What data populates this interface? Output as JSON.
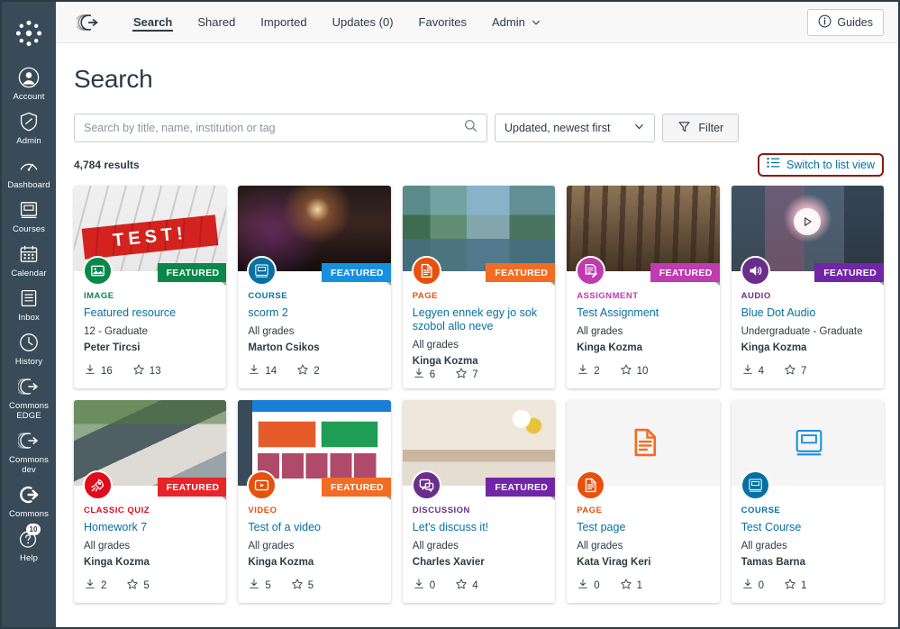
{
  "sidebar": {
    "logo_icon": "canvas-logo-icon",
    "items": [
      {
        "label": "Account",
        "icon": "user-avatar-icon"
      },
      {
        "label": "Admin",
        "icon": "shield-icon"
      },
      {
        "label": "Dashboard",
        "icon": "speedometer-icon"
      },
      {
        "label": "Courses",
        "icon": "book-icon"
      },
      {
        "label": "Calendar",
        "icon": "calendar-icon"
      },
      {
        "label": "Inbox",
        "icon": "envelope-icon"
      },
      {
        "label": "History",
        "icon": "clock-icon"
      },
      {
        "label": "Commons EDGE",
        "icon": "commons-arrow-icon"
      },
      {
        "label": "Commons dev",
        "icon": "commons-arrow-icon"
      },
      {
        "label": "Commons",
        "icon": "commons-arrow-bold-icon"
      },
      {
        "label": "Help",
        "icon": "question-circle-icon",
        "badge": "10"
      }
    ]
  },
  "topbar": {
    "brand_icon": "commons-logo-icon",
    "nav": [
      {
        "label": "Search",
        "active": true
      },
      {
        "label": "Shared",
        "active": false
      },
      {
        "label": "Imported",
        "active": false
      },
      {
        "label": "Updates (0)",
        "active": false
      },
      {
        "label": "Favorites",
        "active": false
      },
      {
        "label": "Admin",
        "active": false,
        "dropdown": true
      }
    ],
    "guides_label": "Guides",
    "guides_icon": "info-circle-icon"
  },
  "page": {
    "title": "Search",
    "results_count": "4,784 results"
  },
  "search": {
    "placeholder": "Search by title, name, institution or tag",
    "value": "",
    "icon": "search-icon"
  },
  "sort": {
    "selected": "Updated, newest first",
    "icon": "chevron-down-icon"
  },
  "filter": {
    "label": "Filter",
    "icon": "funnel-icon"
  },
  "switch_view": {
    "label": "Switch to list view",
    "icon": "list-view-icon",
    "highlight_color": "#8b1a10",
    "link_color": "#0770A3"
  },
  "cards": [
    {
      "type": "IMAGE",
      "type_color": "#0B874B",
      "icon": "image-icon",
      "title": "Featured resource",
      "grades": "12 - Graduate",
      "author": "Peter Tircsi",
      "downloads": "16",
      "stars": "13",
      "featured": true,
      "ribbon_label": "FEATURED",
      "ribbon_color": "#0B874B",
      "thumb": "thumb-keyboard",
      "thumb_text": "TEST!",
      "has_play": false
    },
    {
      "type": "COURSE",
      "type_color": "#0770A3",
      "icon": "book-icon",
      "title": "scorm 2",
      "grades": "All grades",
      "author": "Marton Csikos",
      "downloads": "14",
      "stars": "2",
      "featured": true,
      "ribbon_label": "FEATURED",
      "ribbon_color": "#1790DF",
      "thumb": "thumb-concert",
      "thumb_text": "",
      "has_play": false
    },
    {
      "type": "PAGE",
      "type_color": "#E8500C",
      "icon": "page-icon",
      "title": "Legyen ennek egy jo sok szobol allo neve",
      "grades": "All grades",
      "author": "Kinga Kozma",
      "downloads": "6",
      "stars": "7",
      "featured": true,
      "ribbon_label": "FEATURED",
      "ribbon_color": "#F26C24",
      "thumb": "thumb-river",
      "thumb_text": "",
      "has_play": false
    },
    {
      "type": "ASSIGNMENT",
      "type_color": "#BE3BB0",
      "icon": "assignment-icon",
      "title": "Test Assignment",
      "grades": "All grades",
      "author": "Kinga Kozma",
      "downloads": "2",
      "stars": "10",
      "featured": true,
      "ribbon_label": "FEATURED",
      "ribbon_color": "#BE3BB0",
      "thumb": "thumb-forest",
      "thumb_text": "",
      "has_play": false
    },
    {
      "type": "AUDIO",
      "type_color": "#6B2D8B",
      "icon": "audio-icon",
      "title": "Blue Dot Audio",
      "grades": "Undergraduate - Graduate",
      "author": "Kinga Kozma",
      "downloads": "4",
      "stars": "7",
      "featured": true,
      "ribbon_label": "FEATURED",
      "ribbon_color": "#7026A6",
      "thumb": "thumb-mural",
      "thumb_text": "",
      "has_play": true
    },
    {
      "type": "CLASSIC QUIZ",
      "type_color": "#E00B1C",
      "icon": "rocket-icon",
      "title": "Homework 7",
      "grades": "All grades",
      "author": "Kinga Kozma",
      "downloads": "2",
      "stars": "5",
      "featured": true,
      "ribbon_label": "FEATURED",
      "ribbon_color": "#E62429",
      "thumb": "thumb-desk",
      "thumb_text": "",
      "has_play": false
    },
    {
      "type": "VIDEO",
      "type_color": "#E8500C",
      "icon": "video-icon",
      "title": "Test of a video",
      "grades": "All grades",
      "author": "Kinga Kozma",
      "downloads": "5",
      "stars": "5",
      "featured": true,
      "ribbon_label": "FEATURED",
      "ribbon_color": "#F26C24",
      "thumb": "thumb-screenshot",
      "thumb_text": "",
      "has_play": false
    },
    {
      "type": "DISCUSSION",
      "type_color": "#6B2D8B",
      "icon": "discussion-icon",
      "title": "Let's discuss it!",
      "grades": "All grades",
      "author": "Charles Xavier",
      "downloads": "0",
      "stars": "4",
      "featured": true,
      "ribbon_label": "FEATURED",
      "ribbon_color": "#7026A6",
      "thumb": "thumb-party",
      "thumb_text": "",
      "has_play": false
    },
    {
      "type": "PAGE",
      "type_color": "#E8500C",
      "icon": "page-icon",
      "title": "Test page",
      "grades": "All grades",
      "author": "Kata Virag Keri",
      "downloads": "0",
      "stars": "1",
      "featured": false,
      "ribbon_label": "",
      "ribbon_color": "",
      "thumb": "placeholder",
      "placeholder_icon": "page-icon",
      "placeholder_color": "#F26C24",
      "has_play": false
    },
    {
      "type": "COURSE",
      "type_color": "#0770A3",
      "icon": "book-icon",
      "title": "Test Course",
      "grades": "All grades",
      "author": "Tamas Barna",
      "downloads": "0",
      "stars": "1",
      "featured": false,
      "ribbon_label": "",
      "ribbon_color": "",
      "thumb": "placeholder",
      "placeholder_icon": "book-icon",
      "placeholder_color": "#1790DF",
      "has_play": false
    }
  ]
}
